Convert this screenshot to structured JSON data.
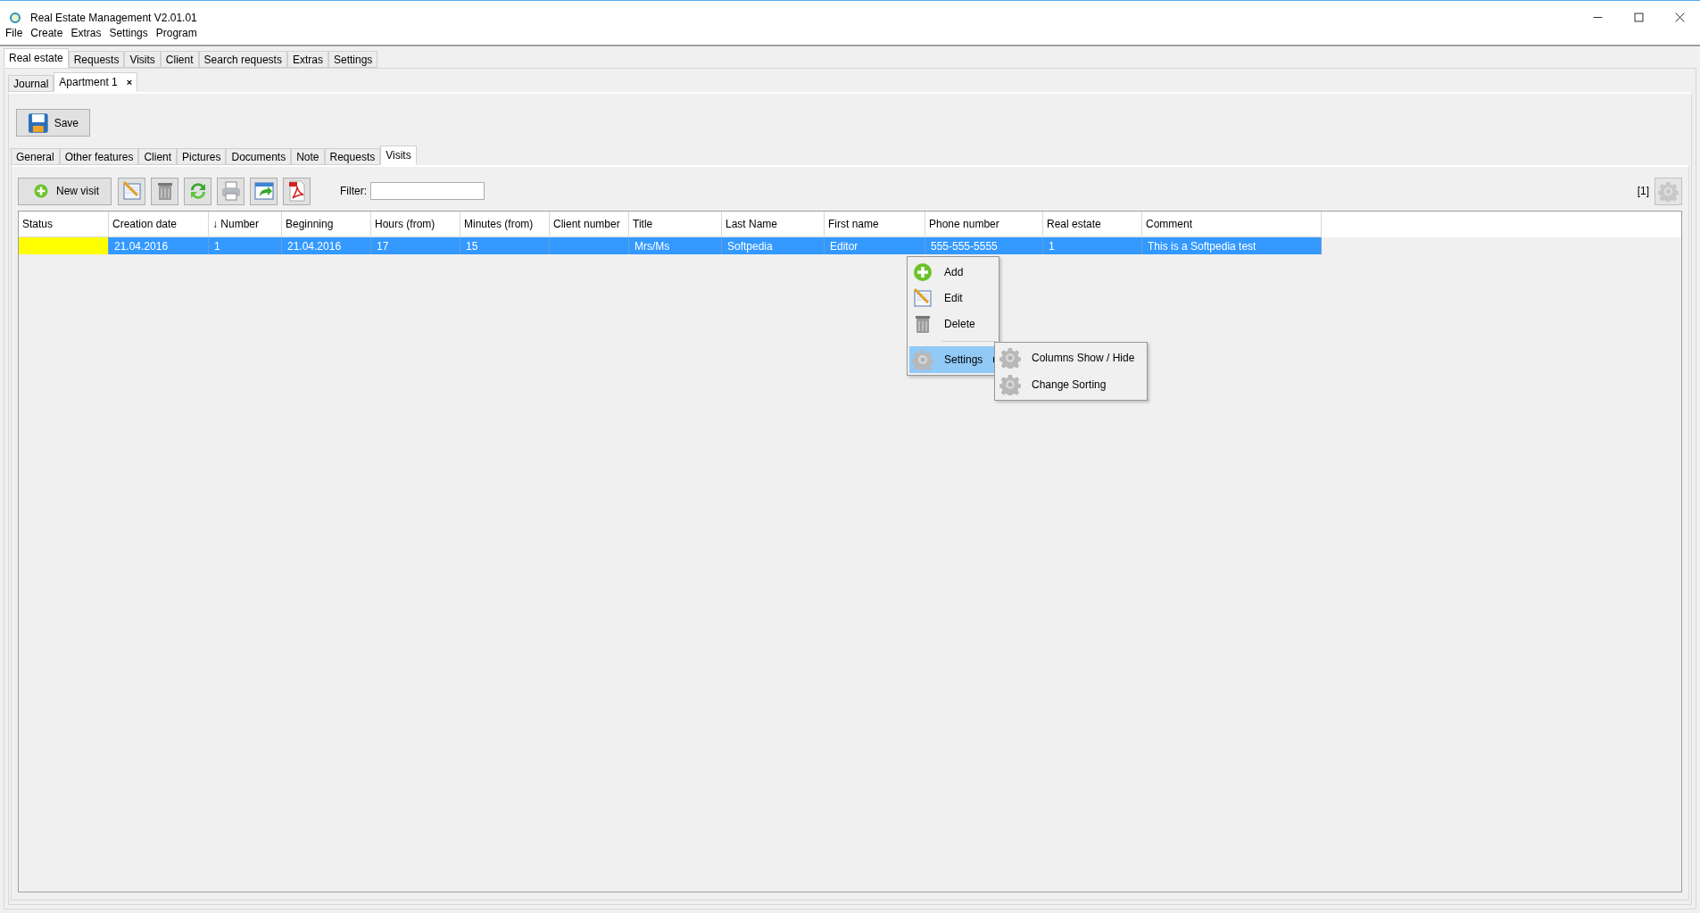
{
  "window": {
    "title": "Real Estate Management V2.01.01"
  },
  "menu": [
    "File",
    "Create",
    "Extras",
    "Settings",
    "Program"
  ],
  "main_tabs": [
    {
      "label": "Real estate",
      "selected": true
    },
    {
      "label": "Requests",
      "selected": false
    },
    {
      "label": "Visits",
      "selected": false
    },
    {
      "label": "Client",
      "selected": false
    },
    {
      "label": "Search requests",
      "selected": false
    },
    {
      "label": "Extras",
      "selected": false
    },
    {
      "label": "Settings",
      "selected": false
    }
  ],
  "doc_tabs": [
    {
      "label": "Journal",
      "selected": false
    },
    {
      "label": "Apartment 1",
      "selected": true,
      "close": "×"
    }
  ],
  "save_button": "Save",
  "detail_tabs": [
    {
      "label": "General",
      "selected": false
    },
    {
      "label": "Other features",
      "selected": false
    },
    {
      "label": "Client",
      "selected": false
    },
    {
      "label": "Pictures",
      "selected": false
    },
    {
      "label": "Documents",
      "selected": false
    },
    {
      "label": "Note",
      "selected": false
    },
    {
      "label": "Requests",
      "selected": false
    },
    {
      "label": "Visits",
      "selected": true
    }
  ],
  "toolbar": {
    "new_button": "New visit",
    "filter_label": "Filter:",
    "count": "[1]"
  },
  "table": {
    "columns": [
      "Status",
      "Creation date",
      "↓ Number",
      "Beginning",
      "Hours (from)",
      "Minutes (from)",
      "Client number",
      "Title",
      "Last Name",
      "First name",
      "Phone number",
      "Real estate",
      "Comment"
    ],
    "rows": [
      {
        "selected": true,
        "color": "#ffff00",
        "cells": [
          "",
          "21.04.2016",
          "1",
          "21.04.2016",
          "17",
          "15",
          "",
          "Mrs/Ms",
          "Softpedia",
          "Editor",
          "555-555-5555",
          "1",
          "This is a Softpedia test"
        ]
      }
    ]
  },
  "context_menu": {
    "items": [
      {
        "kind": "add",
        "label": "Add",
        "selected": false
      },
      {
        "kind": "edit",
        "label": "Edit",
        "selected": false
      },
      {
        "kind": "delete",
        "label": "Delete",
        "selected": false
      },
      {
        "kind": "settings",
        "label": "Settings",
        "selected": true
      }
    ],
    "submenu": [
      {
        "label": "Columns Show / Hide"
      },
      {
        "label": "Change Sorting"
      }
    ]
  }
}
